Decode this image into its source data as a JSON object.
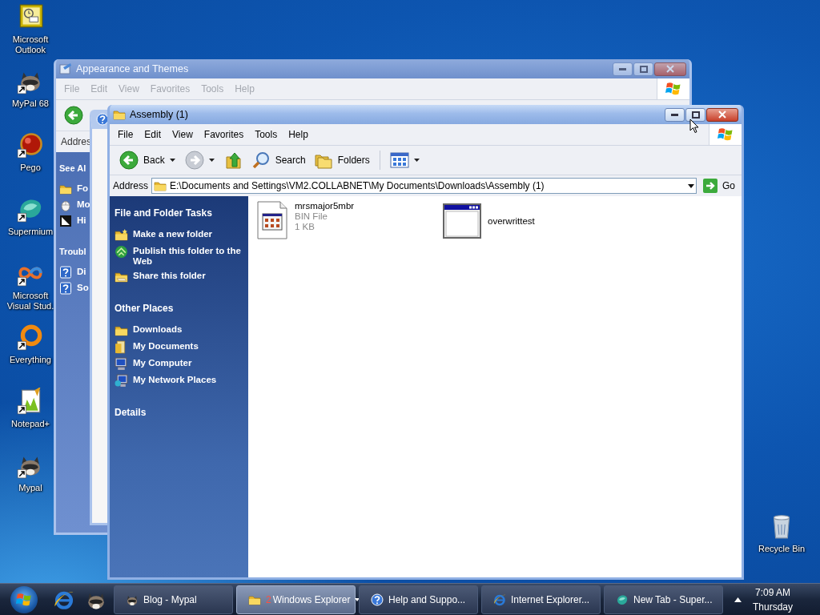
{
  "desktop_icons": [
    {
      "label": "Microsoft Outlook",
      "kind": "outlook",
      "shortcut": false
    },
    {
      "label": "MyPal 68",
      "kind": "mypal",
      "shortcut": true
    },
    {
      "label": "Pego",
      "kind": "pego",
      "shortcut": true
    },
    {
      "label": "Supermium",
      "kind": "supermium",
      "shortcut": true
    },
    {
      "label": "Microsoft Visual Stud.",
      "kind": "vs",
      "shortcut": true
    },
    {
      "label": "Everything",
      "kind": "everything",
      "shortcut": true
    },
    {
      "label": "Notepad+",
      "kind": "notepad",
      "shortcut": true
    },
    {
      "label": "Mypal",
      "kind": "mypal",
      "shortcut": true
    }
  ],
  "recycle_bin": {
    "label": "Recycle Bin",
    "kind": "recycle",
    "shortcut": false
  },
  "back_window": {
    "title": "Appearance and Themes",
    "active": false,
    "menu": [
      "File",
      "Edit",
      "View",
      "Favorites",
      "Tools",
      "Help"
    ],
    "address_label": "Addres",
    "panel": [
      {
        "heading": "See Al",
        "items": [
          {
            "label": "Fo",
            "kind": "folder"
          },
          {
            "label": "Mo",
            "kind": "mouse"
          },
          {
            "label": "Hi",
            "kind": "contrast"
          }
        ]
      },
      {
        "heading": "Troubl",
        "items": [
          {
            "label": "Di",
            "kind": "help"
          },
          {
            "label": "So",
            "kind": "help"
          }
        ]
      }
    ]
  },
  "explorer": {
    "title": "Assembly (1)",
    "active": true,
    "menu": [
      "File",
      "Edit",
      "View",
      "Favorites",
      "Tools",
      "Help"
    ],
    "toolbar": [
      {
        "kind": "back",
        "label": "Back",
        "dropdown": true
      },
      {
        "kind": "forward",
        "dropdown": true
      },
      {
        "kind": "up"
      },
      {
        "kind": "search",
        "label": "Search"
      },
      {
        "kind": "folders",
        "label": "Folders"
      },
      {
        "kind": "views",
        "dropdown": true
      }
    ],
    "address_label": "Address",
    "address": "E:\\Documents and Settings\\VM2.COLLABNET\\My Documents\\Downloads\\Assembly (1)",
    "go": "Go",
    "panel": [
      {
        "heading": "File and Folder Tasks",
        "items": [
          {
            "label": "Make a new folder",
            "kind": "newfolder"
          },
          {
            "label": "Publish this folder to the Web",
            "kind": "globe"
          },
          {
            "label": "Share this folder",
            "kind": "share"
          }
        ]
      },
      {
        "heading": "Other Places",
        "items": [
          {
            "label": "Downloads",
            "kind": "folder"
          },
          {
            "label": "My Documents",
            "kind": "documents"
          },
          {
            "label": "My Computer",
            "kind": "computer"
          },
          {
            "label": "My Network Places",
            "kind": "network"
          }
        ]
      },
      {
        "heading": "Details"
      }
    ],
    "files": [
      {
        "name": "mrsmajor5mbr",
        "type": "BIN File",
        "size": "1 KB",
        "kind": "bin"
      },
      {
        "name": "overwrittest",
        "kind": "app"
      }
    ]
  },
  "taskbar": {
    "quick_launch": [
      {
        "kind": "ie"
      },
      {
        "kind": "mypal"
      }
    ],
    "tasks": [
      {
        "label": "Blog - Mypal",
        "kind": "mypal",
        "selected": false
      },
      {
        "label": "Windows Explorer",
        "count": "2",
        "kind": "folder",
        "selected": true,
        "dropdown": true
      },
      {
        "label": "Help and Suppo...",
        "kind": "help",
        "selected": false
      },
      {
        "label": "Internet Explorer...",
        "kind": "ie",
        "selected": false
      },
      {
        "label": "New Tab - Super...",
        "kind": "supermium",
        "selected": false
      }
    ],
    "time": "7:09 AM",
    "day": "Thursday"
  }
}
